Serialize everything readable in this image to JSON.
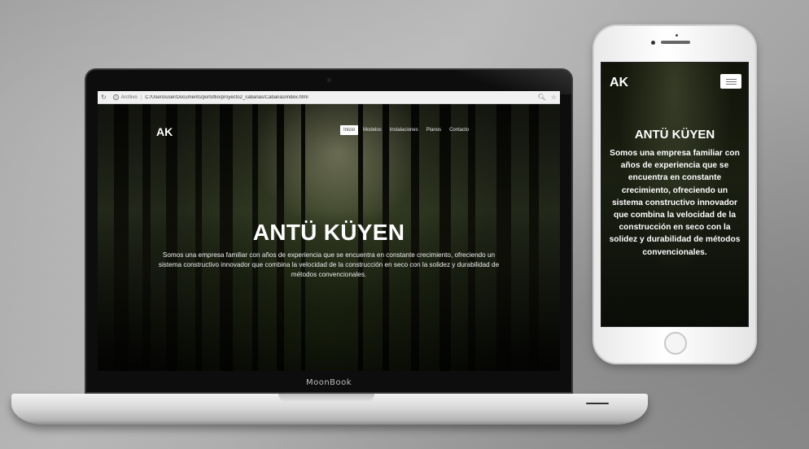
{
  "browser": {
    "scheme_label": "Archivo",
    "separator": "|",
    "url": "C:/Users/user/Documents/portoflio/proyecto2_cabañas/Cabañas/index.html"
  },
  "site": {
    "logo": "AK",
    "nav": [
      {
        "label": "Inicio",
        "active": true
      },
      {
        "label": "Modelos",
        "active": false
      },
      {
        "label": "Instalaciones",
        "active": false
      },
      {
        "label": "Planos",
        "active": false
      },
      {
        "label": "Contacto",
        "active": false
      }
    ],
    "hero_title": "ANTÜ KÜYEN",
    "hero_text": "Somos una empresa familiar con años de experiencia que se encuentra en constante crecimiento, ofreciendo un sistema constructivo innovador que combina la velocidad de la construcción en seco con la solidez y durabilidad de métodos convencionales."
  },
  "laptop": {
    "brand": "MoonBook"
  },
  "mobile": {
    "logo": "AK",
    "hero_title": "ANTÜ KÜYEN",
    "hero_text": "Somos una empresa familiar con años de experiencia que se encuentra en constante crecimiento, ofreciendo un sistema constructivo innovador que combina la velocidad de la construcción en seco con la solidez y durabilidad de métodos convencionales."
  },
  "icons": [
    "reload-icon",
    "info-icon",
    "search-icon",
    "bookmark-star-icon",
    "hamburger-menu-icon"
  ]
}
